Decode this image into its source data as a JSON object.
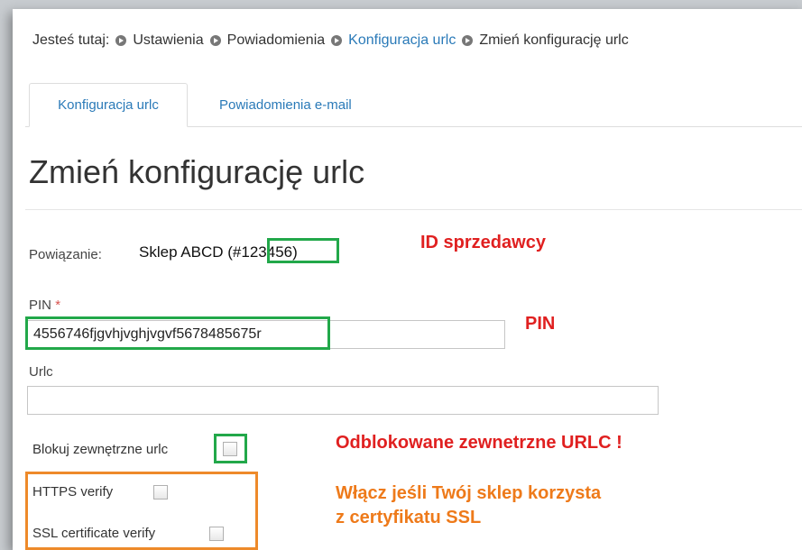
{
  "breadcrumb": {
    "prefix": "Jesteś tutaj:",
    "items": [
      {
        "label": "Ustawienia",
        "link": false
      },
      {
        "label": "Powiadomienia",
        "link": false
      },
      {
        "label": "Konfiguracja urlc",
        "link": true
      },
      {
        "label": "Zmień konfigurację urlc",
        "link": false
      }
    ]
  },
  "tabs": [
    {
      "label": "Konfiguracja urlc",
      "active": true
    },
    {
      "label": "Powiadomienia e-mail",
      "active": false
    }
  ],
  "page_title": "Zmień konfigurację urlc",
  "form": {
    "association_label": "Powiązanie:",
    "association_value": "Sklep ABCD (#123456)",
    "pin_label": "PIN",
    "pin_required_mark": "*",
    "pin_value": "4556746fjgvhjvghjvgvf5678485675r",
    "urlc_label": "Urlc",
    "urlc_value": "",
    "block_external_label": "Blokuj zewnętrzne urlc",
    "block_external_checked": false,
    "https_verify_label": "HTTPS verify",
    "https_verify_checked": false,
    "ssl_verify_label": "SSL certificate verify",
    "ssl_verify_checked": false
  },
  "annotations": {
    "seller_id": "ID sprzedawcy",
    "pin": "PIN",
    "unblocked": "Odblokowane zewnetrzne URLC !",
    "ssl_line1": "Włącz jeśli Twój sklep korzysta",
    "ssl_line2": "z certyfikatu SSL"
  },
  "colors": {
    "link": "#2a7ab8",
    "highlight_green": "#22a84a",
    "annotation_red": "#e02020",
    "annotation_orange": "#ee7a1a",
    "required": "#d9534f"
  }
}
